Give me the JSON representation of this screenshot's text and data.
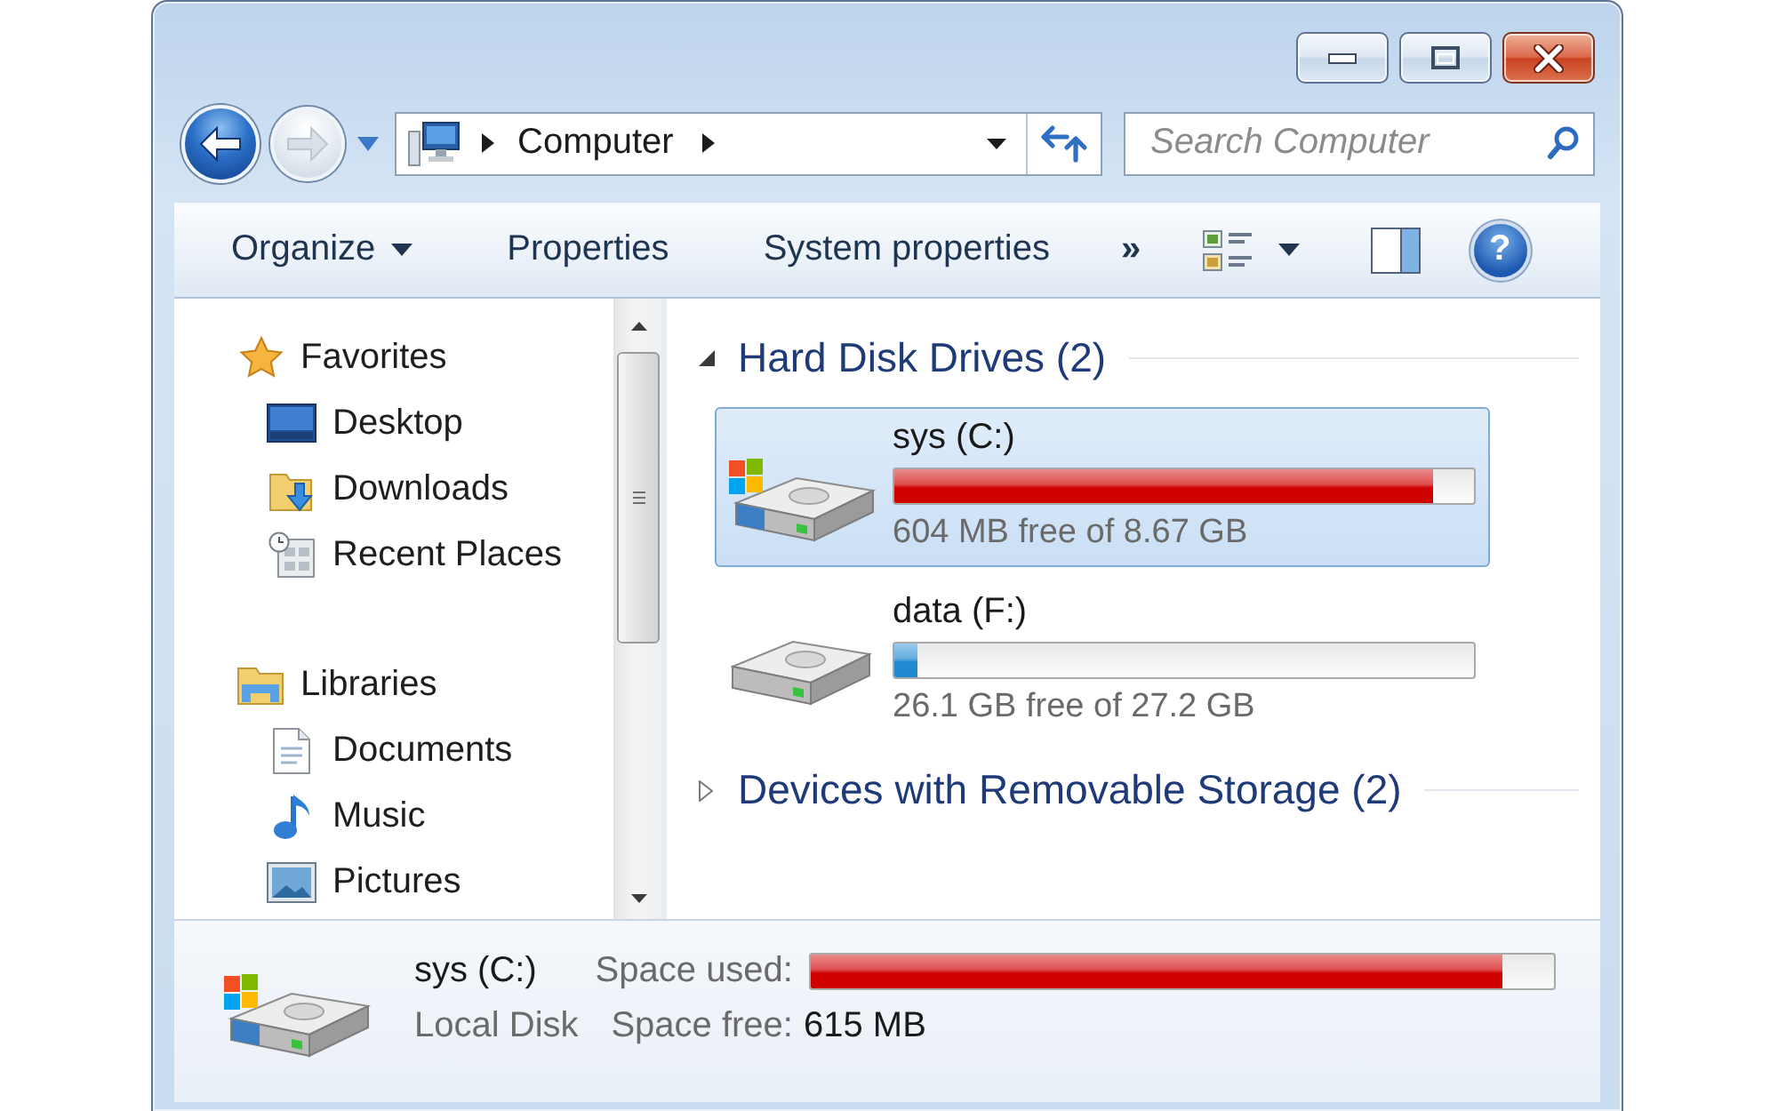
{
  "navigation": {
    "back": {
      "disabled": false
    },
    "forward": {
      "disabled": true
    },
    "address": {
      "segments": [
        "Computer"
      ]
    },
    "search": {
      "placeholder": "Search Computer"
    }
  },
  "toolbar": {
    "items": [
      {
        "label": "Organize",
        "kind": "menu"
      },
      {
        "label": "Properties",
        "kind": "button"
      },
      {
        "label": "System properties",
        "kind": "button"
      },
      {
        "label": "»",
        "kind": "overflow"
      }
    ],
    "help": "?"
  },
  "sidebar": {
    "groups": [
      {
        "label": "Favorites",
        "kind": "favorites",
        "selected": false,
        "children": [
          {
            "label": "Desktop",
            "kind": "desktop",
            "selected": false
          },
          {
            "label": "Downloads",
            "kind": "downloads",
            "selected": false
          },
          {
            "label": "Recent Places",
            "kind": "recent",
            "selected": false
          }
        ]
      },
      {
        "label": "Libraries",
        "kind": "libraries",
        "selected": false,
        "children": [
          {
            "label": "Documents",
            "kind": "documents",
            "selected": false
          },
          {
            "label": "Music",
            "kind": "music",
            "selected": false
          },
          {
            "label": "Pictures",
            "kind": "pictures",
            "selected": false
          }
        ]
      }
    ]
  },
  "content": {
    "groups": [
      {
        "title": "Hard Disk Drives (2)",
        "expanded": true,
        "drives": [
          {
            "name": "sys (C:)",
            "kind": "system",
            "selected": true,
            "level": 0.93,
            "low_space": true,
            "free_space": "604 MB free of 8.67 GB"
          },
          {
            "name": "data (F:)",
            "kind": "data",
            "selected": false,
            "level": 0.04,
            "low_space": false,
            "free_space": "26.1 GB free of 27.2 GB"
          }
        ]
      },
      {
        "title": "Devices with Removable Storage (2)",
        "expanded": false
      }
    ]
  },
  "details": {
    "name": "sys (C:)",
    "kind": "system",
    "type": "Local Disk",
    "used_label": "Space used:",
    "level": 0.93,
    "low_space": true,
    "free_label": "Space free:",
    "free_value": "615 MB"
  }
}
